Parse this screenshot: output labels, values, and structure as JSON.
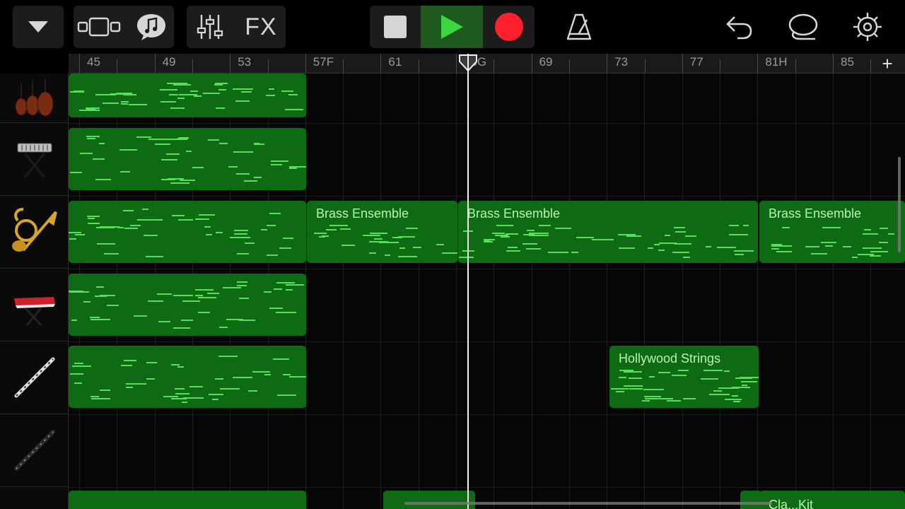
{
  "toolbar": {
    "browse_icon": "triangle-down-icon",
    "view_icon": "tracks-view-icon",
    "loops_icon": "music-note-bubble-icon",
    "mixer_icon": "sliders-icon",
    "fx_label": "FX",
    "stop_icon": "stop-icon",
    "play_icon": "play-icon",
    "record_icon": "record-icon",
    "metronome_icon": "metronome-icon",
    "undo_icon": "undo-icon",
    "loop_browser_icon": "lasso-icon",
    "settings_icon": "gear-icon",
    "colors": {
      "play_bg": "#1e5a1e",
      "play_fill": "#3cd642",
      "record": "#ff1f2d",
      "stop": "#d6d6d6"
    }
  },
  "ruler": {
    "labels": [
      "45",
      "49",
      "53",
      "57F",
      "61",
      "65G",
      "69",
      "73",
      "77",
      "81H",
      "85"
    ],
    "add_button": "+"
  },
  "tracks": [
    {
      "instrument_icon": "orchestra-strings-icon"
    },
    {
      "instrument_icon": "keyboard-stand-icon"
    },
    {
      "instrument_icon": "brass-instruments-icon"
    },
    {
      "instrument_icon": "red-synth-keyboard-icon"
    },
    {
      "instrument_icon": "flute-icon"
    },
    {
      "instrument_icon": "clarinet-icon"
    }
  ],
  "regions": {
    "brass_1": "Brass Ensemble",
    "brass_2": "Brass Ensemble",
    "brass_3": "Brass Ensemble",
    "strings": "Hollywood Strings",
    "drums": "Cla...Kit"
  },
  "colors": {
    "region": "#0f6a14",
    "note": "#56e05a",
    "region_label": "#b9f3b2"
  }
}
